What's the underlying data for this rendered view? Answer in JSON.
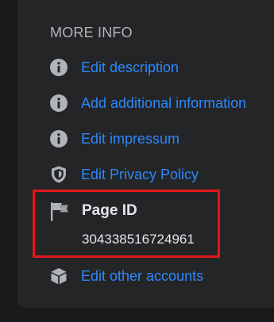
{
  "section": {
    "title": "MORE INFO"
  },
  "items": [
    {
      "label": "Edit description",
      "icon": "info-icon"
    },
    {
      "label": "Add additional information",
      "icon": "info-icon"
    },
    {
      "label": "Edit impressum",
      "icon": "info-icon"
    },
    {
      "label": "Edit Privacy Policy",
      "icon": "shield-icon"
    }
  ],
  "page_id": {
    "label": "Page ID",
    "value": "304338516724961",
    "icon": "flag-icon"
  },
  "other_accounts": {
    "label": "Edit other accounts",
    "icon": "cube-icon"
  },
  "colors": {
    "background": "#18191a",
    "card": "#242526",
    "link": "#2d88ff",
    "heading": "#b0b3b8",
    "text": "#e4e6eb",
    "icon": "#b0b3b8",
    "highlight_border": "#e0161c"
  }
}
